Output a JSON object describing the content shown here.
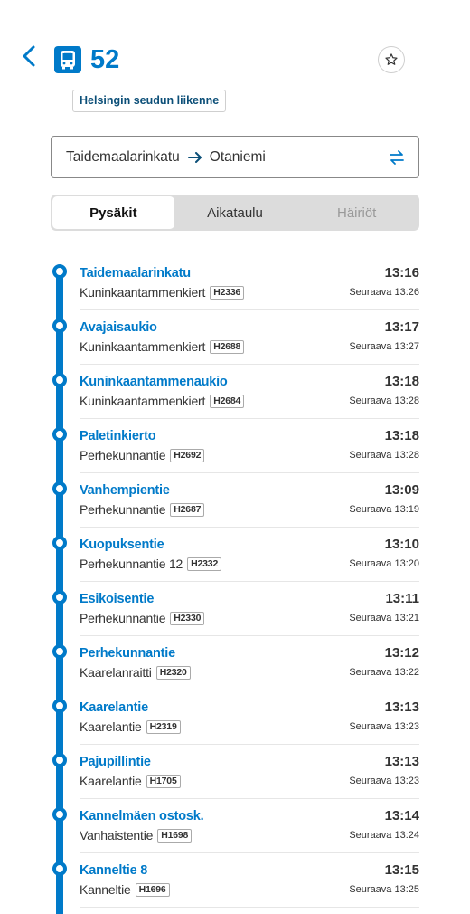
{
  "header": {
    "route_number": "52",
    "agency": "Helsingin seudun liikenne",
    "icons": {
      "back": "chevron-left-icon",
      "route": "bus-icon",
      "favourite": "star-icon"
    }
  },
  "pattern": {
    "from": "Taidemaalarinkatu",
    "to": "Otaniemi",
    "icons": {
      "arrow": "arrow-right-icon",
      "swap": "swap-icon"
    }
  },
  "tabs": [
    {
      "label": "Pysäkit",
      "active": true,
      "disabled": false
    },
    {
      "label": "Aikataulu",
      "active": false,
      "disabled": false
    },
    {
      "label": "Häiriöt",
      "active": false,
      "disabled": true
    }
  ],
  "colors": {
    "accent": "#007ac9",
    "agency_text": "#0c4f78"
  },
  "stops": [
    {
      "name": "Taidemaalarinkatu",
      "address": "Kuninkaantammenkiert",
      "code": "H2336",
      "time": "13:16",
      "next": "Seuraava 13:26"
    },
    {
      "name": "Avajaisaukio",
      "address": "Kuninkaantammenkiert",
      "code": "H2688",
      "time": "13:17",
      "next": "Seuraava 13:27"
    },
    {
      "name": "Kuninkaantammenaukio",
      "address": "Kuninkaantammenkiert",
      "code": "H2684",
      "time": "13:18",
      "next": "Seuraava 13:28"
    },
    {
      "name": "Paletinkierto",
      "address": "Perhekunnantie",
      "code": "H2692",
      "time": "13:18",
      "next": "Seuraava 13:28"
    },
    {
      "name": "Vanhempientie",
      "address": "Perhekunnantie",
      "code": "H2687",
      "time": "13:09",
      "next": "Seuraava 13:19"
    },
    {
      "name": "Kuopuksentie",
      "address": "Perhekunnantie 12",
      "code": "H2332",
      "time": "13:10",
      "next": "Seuraava 13:20"
    },
    {
      "name": "Esikoisentie",
      "address": "Perhekunnantie",
      "code": "H2330",
      "time": "13:11",
      "next": "Seuraava 13:21"
    },
    {
      "name": "Perhekunnantie",
      "address": "Kaarelanraitti",
      "code": "H2320",
      "time": "13:12",
      "next": "Seuraava 13:22"
    },
    {
      "name": "Kaarelantie",
      "address": "Kaarelantie",
      "code": "H2319",
      "time": "13:13",
      "next": "Seuraava 13:23"
    },
    {
      "name": "Pajupillintie",
      "address": "Kaarelantie",
      "code": "H1705",
      "time": "13:13",
      "next": "Seuraava 13:23"
    },
    {
      "name": "Kannelmäen ostosk.",
      "address": "Vanhaistentie",
      "code": "H1698",
      "time": "13:14",
      "next": "Seuraava 13:24"
    },
    {
      "name": "Kanneltie 8",
      "address": "Kanneltie",
      "code": "H1696",
      "time": "13:15",
      "next": "Seuraava 13:25"
    }
  ]
}
